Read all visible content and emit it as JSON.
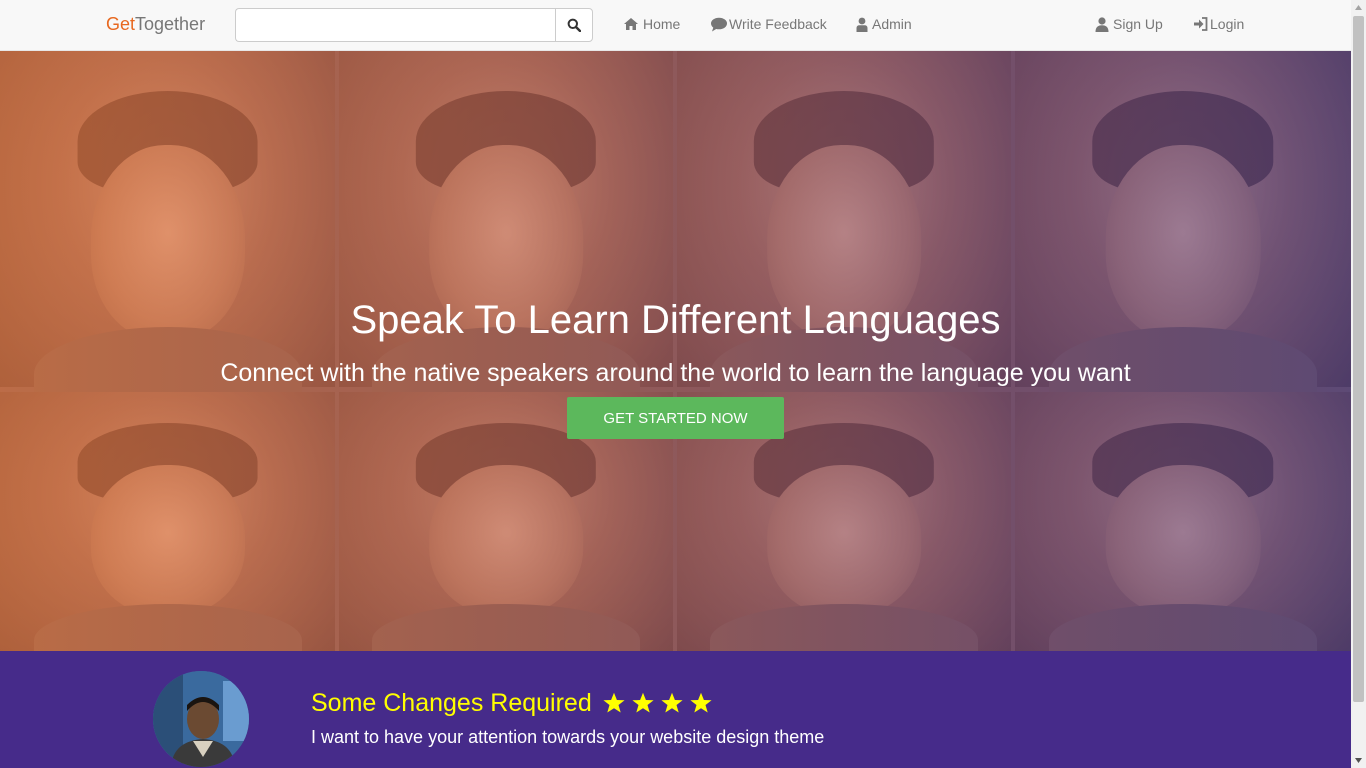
{
  "navbar": {
    "brand_prefix": "Get",
    "brand_suffix": "Together",
    "search_placeholder": "",
    "search_value": "",
    "links": {
      "home": "Home",
      "feedback": "Write Feedback",
      "admin": "Admin",
      "signup": "Sign Up",
      "login": "Login"
    }
  },
  "hero": {
    "title": "Speak To Learn Different Languages",
    "subtitle": "Connect with the native speakers around the world to learn the language you want",
    "cta_label": "GET STARTED NOW"
  },
  "testimonial": {
    "title": "Some Changes Required",
    "rating": 4,
    "text": "I want to have your attention towards your website design theme"
  },
  "colors": {
    "brand_accent": "#e8681f",
    "cta": "#5cb85c",
    "band": "#462b8a",
    "review_title": "#ffff00",
    "navbar_bg": "#f8f8f8"
  }
}
